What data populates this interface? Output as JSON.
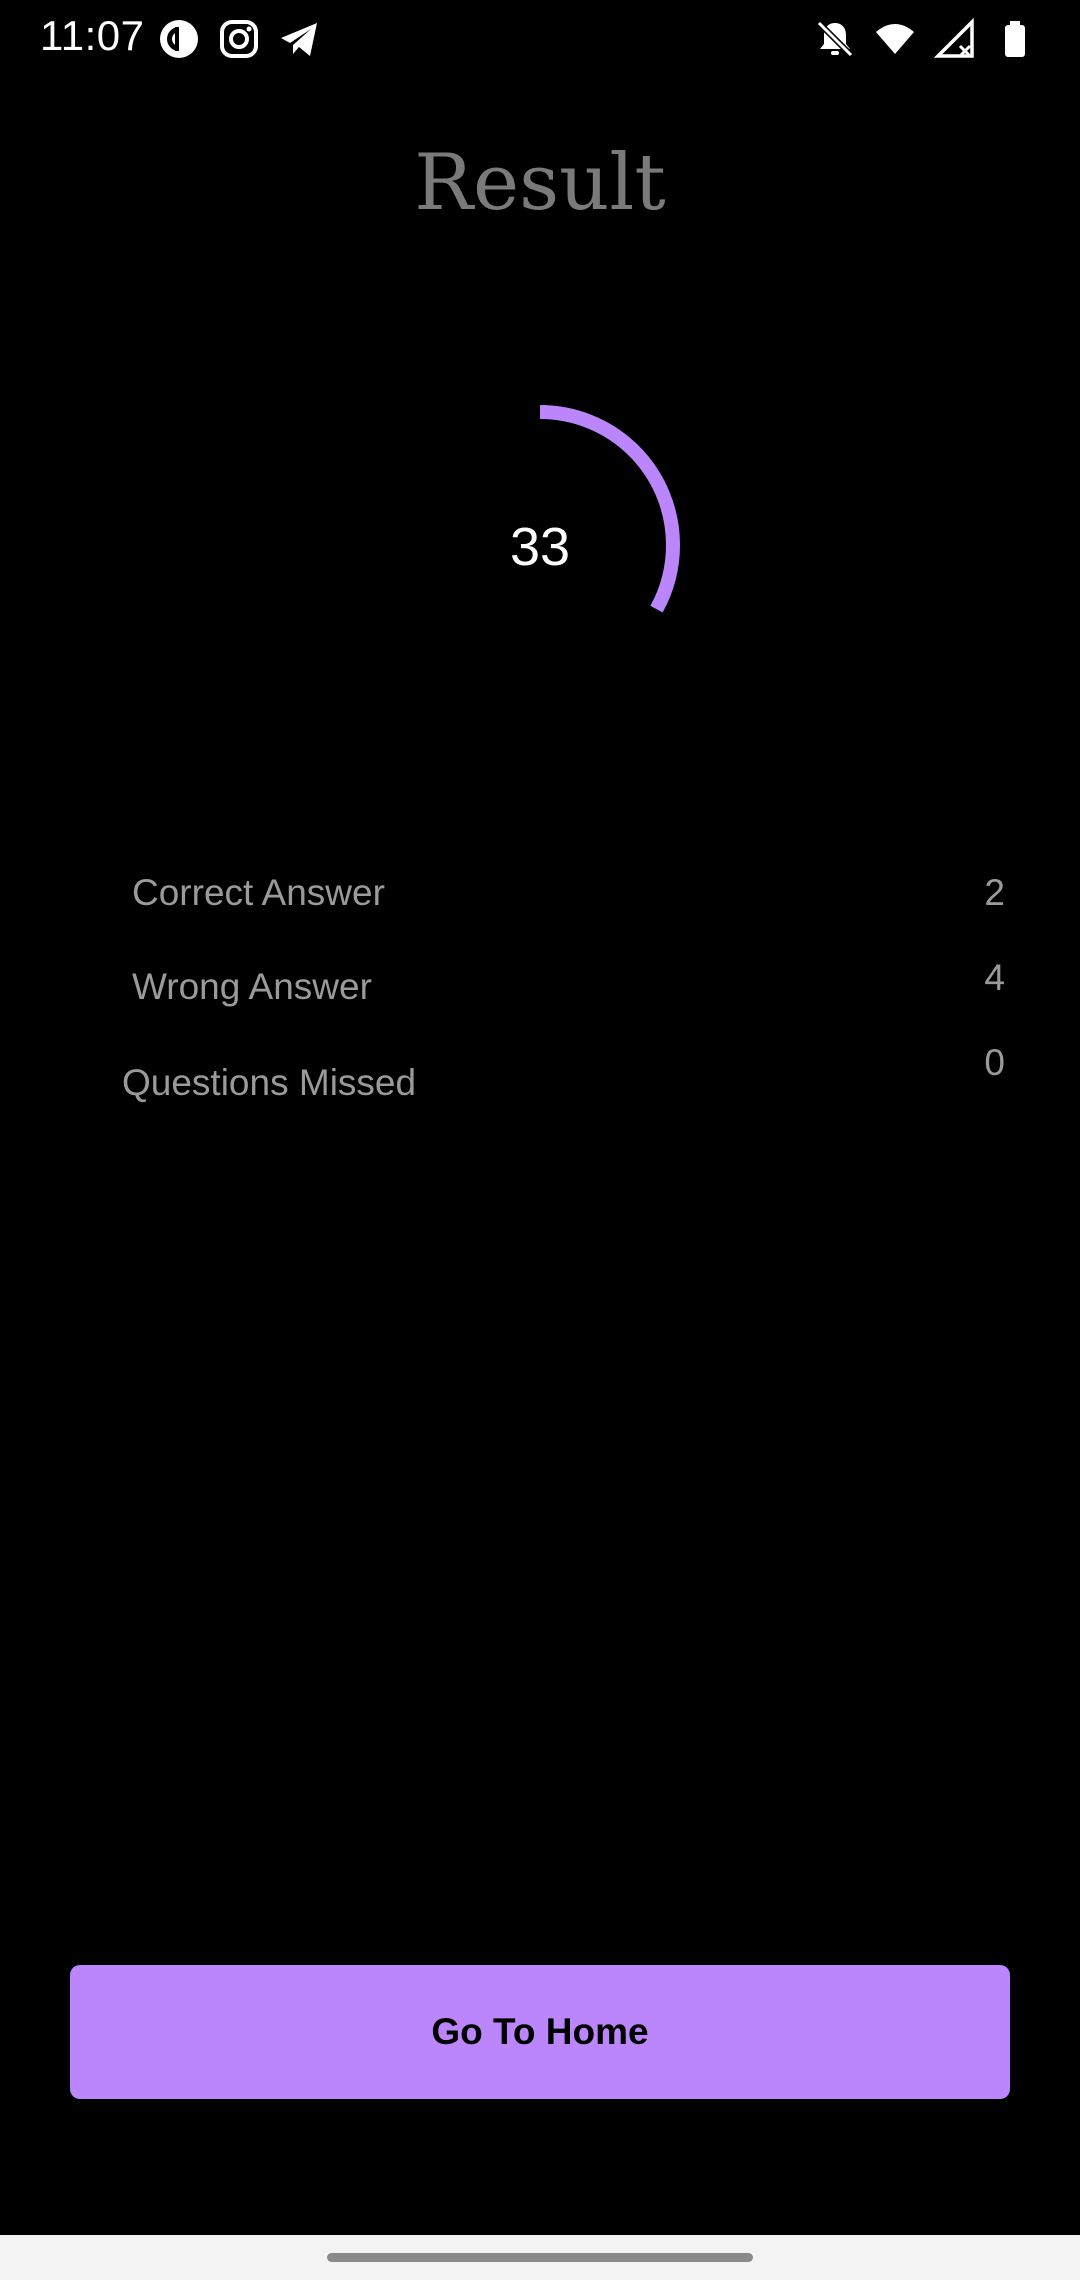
{
  "status_bar": {
    "time": "11:07",
    "left_icons": [
      "pocket-casts-icon",
      "instagram-icon",
      "telegram-icon"
    ],
    "right_icons": [
      "bell-off-icon",
      "wifi-icon",
      "signal-icon",
      "battery-icon"
    ]
  },
  "title": "Result",
  "score": {
    "value": "33",
    "percent": 33,
    "color": "#bb86fc"
  },
  "stats": [
    {
      "label": "Correct Answer",
      "value": "2"
    },
    {
      "label": "Wrong Answer",
      "value": "4"
    },
    {
      "label": "Questions Missed",
      "value": "0"
    }
  ],
  "button": {
    "label": "Go To Home",
    "color": "#bb86fc"
  },
  "colors": {
    "background": "#000000",
    "accent": "#bb86fc",
    "muted_text": "#9a9a9a",
    "title_text": "#7a7a7a"
  }
}
